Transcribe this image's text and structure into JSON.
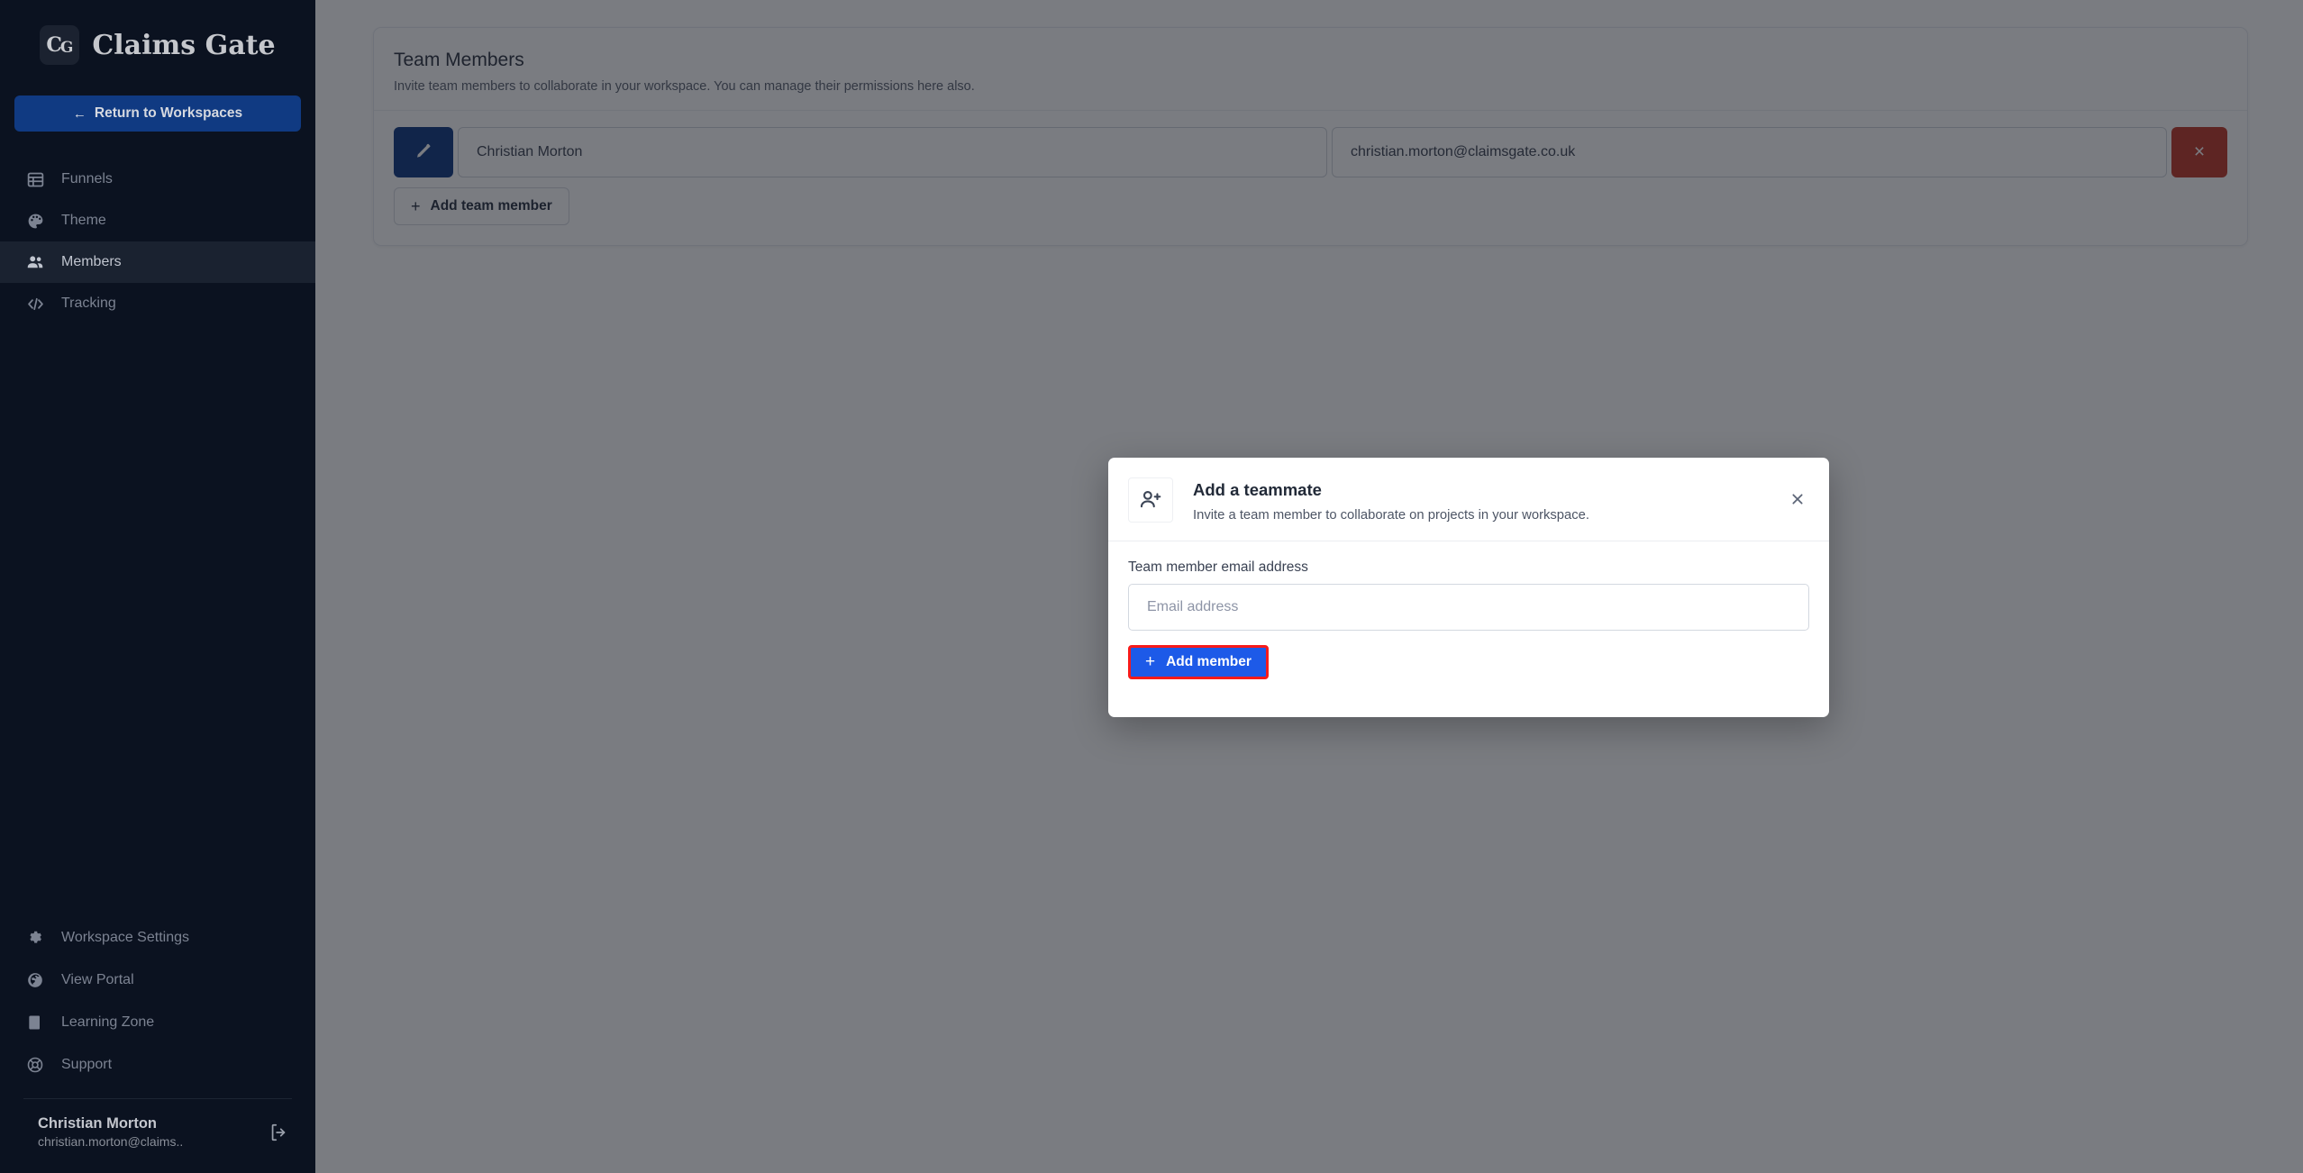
{
  "brand": {
    "mark_primary": "C",
    "mark_secondary": "G",
    "name": "Claims Gate"
  },
  "sidebar": {
    "return_button": {
      "label": "Return to Workspaces",
      "arrow": "←"
    },
    "nav_items": [
      {
        "label": "Funnels",
        "icon": "table-icon",
        "active": false
      },
      {
        "label": "Theme",
        "icon": "palette-icon",
        "active": false
      },
      {
        "label": "Members",
        "icon": "people-icon",
        "active": true
      },
      {
        "label": "Tracking",
        "icon": "code-icon",
        "active": false
      }
    ],
    "bottom_items": [
      {
        "label": "Workspace Settings",
        "icon": "gear-icon"
      },
      {
        "label": "View Portal",
        "icon": "globe-icon"
      },
      {
        "label": "Learning Zone",
        "icon": "book-icon"
      },
      {
        "label": "Support",
        "icon": "lifebuoy-icon"
      }
    ],
    "user": {
      "name": "Christian Morton",
      "email": "christian.morton@claims..",
      "logout_icon": "logout-icon"
    }
  },
  "card": {
    "title": "Team Members",
    "subtitle": "Invite team members to collaborate in your workspace. You can manage their permissions here also.",
    "members": [
      {
        "name": "Christian Morton",
        "email": "christian.morton@claimsgate.co.uk",
        "edit_icon": "pencil-icon",
        "delete_label": "×"
      }
    ],
    "add_team_member_label": "Add team member",
    "add_plus": "+"
  },
  "modal": {
    "icon": "user-plus-icon",
    "title": "Add a teammate",
    "description": "Invite a team member to collaborate on projects in your workspace.",
    "close_label": "×",
    "email_field_label": "Team member email address",
    "email_placeholder": "Email address",
    "email_value": "",
    "submit_label": "Add member",
    "submit_plus": "+"
  },
  "colors": {
    "sidebar_bg": "#0b1220",
    "accent_blue": "#103a82",
    "primary_blue": "#1d5ae8",
    "danger_red": "#c0392b",
    "highlight_red": "#f71b1b"
  }
}
